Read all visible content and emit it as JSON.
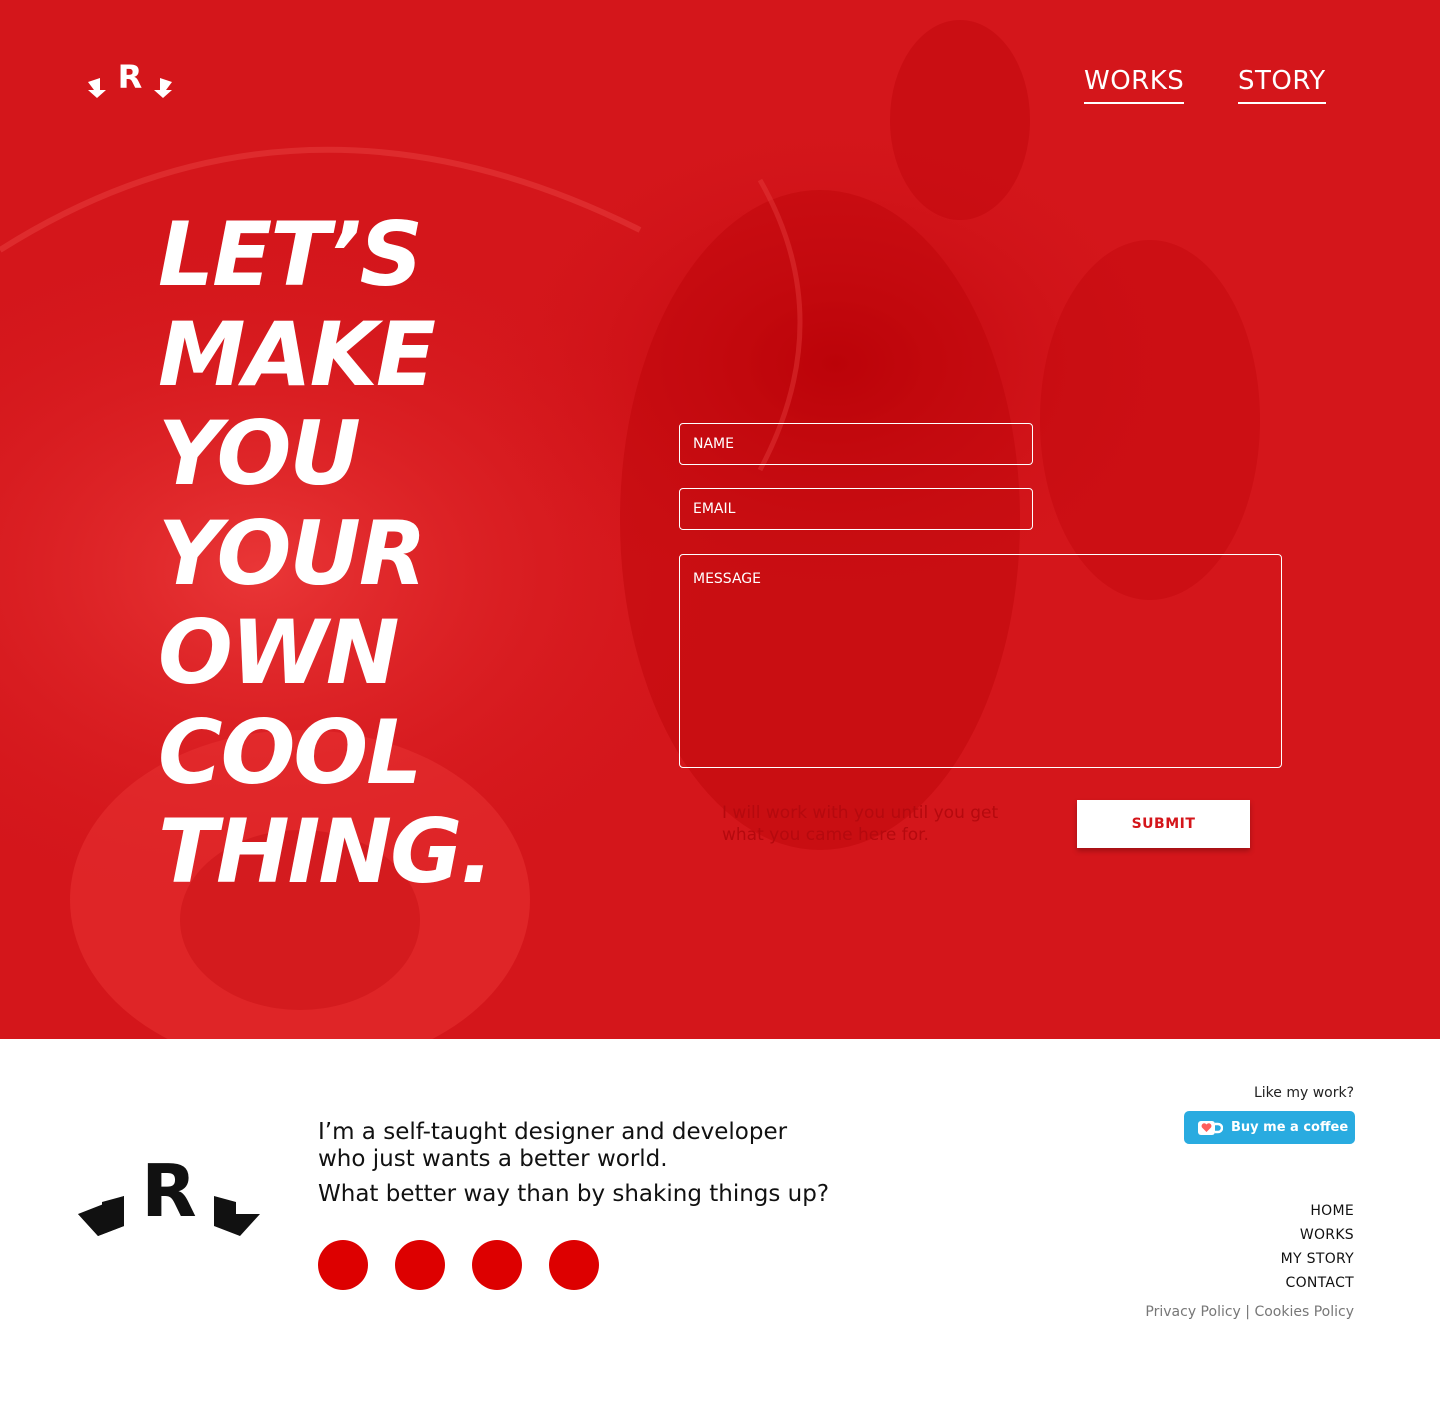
{
  "nav": {
    "works_label": "WORKS",
    "story_label": "STORY"
  },
  "hero": {
    "headline_lines": [
      "LET’S",
      "MAKE",
      "YOU",
      "YOUR",
      "OWN",
      "COOL",
      "THING."
    ]
  },
  "form": {
    "name_placeholder": "NAME",
    "email_placeholder": "EMAIL",
    "message_placeholder": "MESSAGE",
    "note": "I will work with you until you get what you came here for.",
    "submit_label": "SUBMIT"
  },
  "footer": {
    "tagline_line1": "I’m a self-taught designer and developer",
    "tagline_line2": "who just wants a better world.",
    "tagline_line3": "What better way than by shaking things up?",
    "like_text": "Like my work?",
    "coffee_label": "Buy me a coffee",
    "nav_items": [
      "HOME",
      "WORKS",
      "MY STORY",
      "CONTACT"
    ],
    "privacy_label": "Privacy Policy",
    "separator": " | ",
    "cookies_label": "Cookies Policy"
  },
  "colors": {
    "brand_red": "#d4161b",
    "social_red": "#dd0000",
    "coffee_blue": "#29abe0"
  }
}
